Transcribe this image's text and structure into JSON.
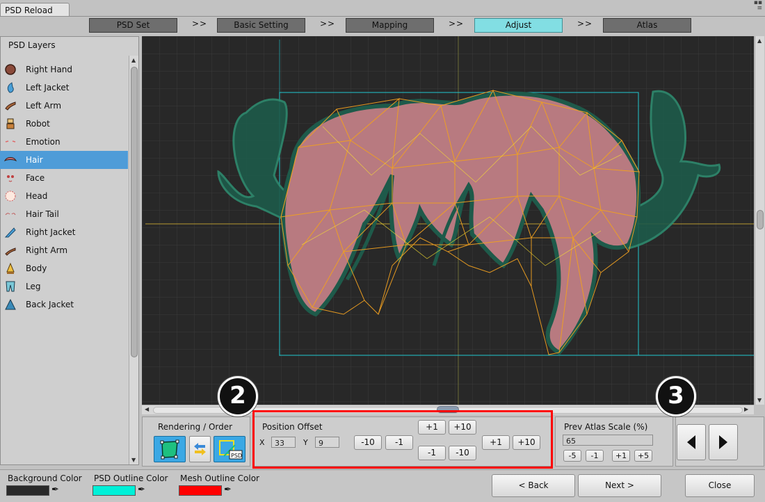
{
  "window": {
    "title": "PSD Reload"
  },
  "steps": [
    {
      "label": "PSD Set",
      "active": false
    },
    {
      "label": "Basic Setting",
      "active": false
    },
    {
      "label": "Mapping",
      "active": false
    },
    {
      "label": "Adjust",
      "active": true
    },
    {
      "label": "Atlas",
      "active": false
    }
  ],
  "step_separator": ">>",
  "layers_panel": {
    "title": "PSD Layers",
    "items": [
      {
        "label": "Right Hand",
        "icon": "hand-icon"
      },
      {
        "label": "Left Jacket",
        "icon": "jacket-icon"
      },
      {
        "label": "Left Arm",
        "icon": "arm-icon"
      },
      {
        "label": "Robot",
        "icon": "robot-icon"
      },
      {
        "label": "Emotion",
        "icon": "emotion-icon"
      },
      {
        "label": "Hair",
        "icon": "hair-icon",
        "selected": true
      },
      {
        "label": "Face",
        "icon": "face-icon"
      },
      {
        "label": "Head",
        "icon": "head-icon"
      },
      {
        "label": "Hair Tail",
        "icon": "hair-tail-icon"
      },
      {
        "label": "Right Jacket",
        "icon": "jacket-icon"
      },
      {
        "label": "Right Arm",
        "icon": "arm-icon"
      },
      {
        "label": "Body",
        "icon": "body-icon"
      },
      {
        "label": "Leg",
        "icon": "leg-icon"
      },
      {
        "label": "Back Jacket",
        "icon": "jacket-icon"
      }
    ]
  },
  "rendering": {
    "title": "Rendering / Order"
  },
  "position_offset": {
    "title": "Position Offset",
    "x_label": "X",
    "x_value": "33",
    "y_label": "Y",
    "y_value": "9",
    "x_minus10": "-10",
    "x_minus1": "-1",
    "x_plus1": "+1",
    "x_plus10": "+10",
    "y_plus1": "+1",
    "y_plus10": "+10",
    "y_minus1": "-1",
    "y_minus10": "-10"
  },
  "atlas_scale": {
    "title": "Prev Atlas Scale (%)",
    "value": "65",
    "buttons": [
      "-5",
      "-1",
      "+1",
      "+5"
    ]
  },
  "badges": {
    "left": "2",
    "right": "3"
  },
  "colors": {
    "background_label": "Background Color",
    "background_value": "#2a2a2a",
    "psd_outline_label": "PSD Outline Color",
    "psd_outline_value": "#00f0d8",
    "mesh_outline_label": "Mesh Outline Color",
    "mesh_outline_value": "#ff0000"
  },
  "footer": {
    "back": "< Back",
    "next": "Next >",
    "close": "Close"
  }
}
